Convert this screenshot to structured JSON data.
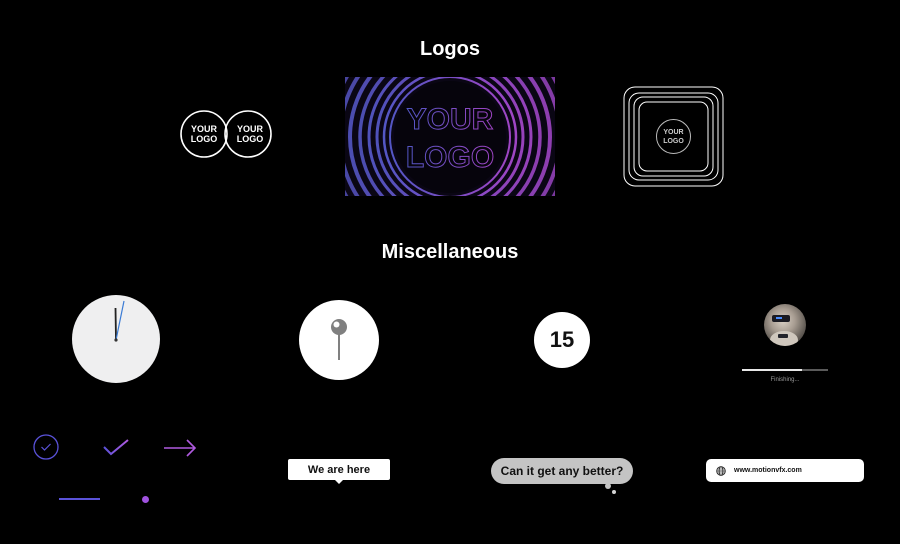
{
  "sections": {
    "logos_title": "Logos",
    "misc_title": "Miscellaneous"
  },
  "logos": {
    "circles": {
      "left_text_1": "YOUR",
      "left_text_2": "LOGO",
      "right_text_1": "YOUR",
      "right_text_2": "LOGO"
    },
    "tunnel": {
      "text_1": "YOUR",
      "text_2": "LOGO",
      "gradient_start": "#5b5fd8",
      "gradient_end": "#b04cd8"
    },
    "squares": {
      "text_1": "YOUR",
      "text_2": "LOGO"
    }
  },
  "misc": {
    "clock": {
      "face_color": "#efeff0",
      "hand_color": "#222222",
      "second_hand_color": "#3a7bd5"
    },
    "pin": {
      "color": "#808080"
    },
    "number_badge": "15",
    "avatar": {
      "status_label": "Finishing...",
      "progress": 0.7
    },
    "icons": {
      "check_circle_color": "#5a52d9",
      "check_gradient": [
        "#5a52d9",
        "#a052e0"
      ],
      "arrow_color": "#b05ae0",
      "line_color": "#5a52d9",
      "dot_color": "#a052e0"
    },
    "tooltip_label": "We are here",
    "thought_bubble_label": "Can it get any better?",
    "urlbar": {
      "url": "www.motionvfx.com",
      "icon": "globe-icon"
    }
  }
}
